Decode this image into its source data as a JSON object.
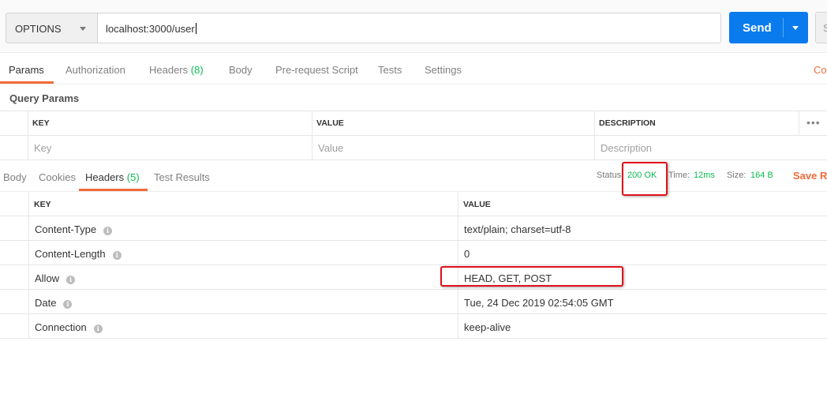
{
  "request": {
    "method": "OPTIONS",
    "url": "localhost:3000/user",
    "send_label": "Send",
    "save_label_partial": "S"
  },
  "request_tabs": {
    "params": "Params",
    "authorization": "Authorization",
    "headers": "Headers",
    "headers_count": "(8)",
    "body": "Body",
    "pre_request": "Pre-request Script",
    "tests": "Tests",
    "settings": "Settings",
    "cookies_partial": "Coo"
  },
  "query_params": {
    "title": "Query Params",
    "columns": [
      "KEY",
      "VALUE",
      "DESCRIPTION"
    ],
    "placeholders": {
      "key": "Key",
      "value": "Value",
      "description": "Description"
    },
    "more": "•••"
  },
  "response_tabs": {
    "body": "Body",
    "cookies": "Cookies",
    "headers": "Headers",
    "headers_count": "(5)",
    "test_results": "Test Results"
  },
  "response_meta": {
    "status_label": "Status:",
    "status_value": "200 OK",
    "time_label": "Time:",
    "time_value": "12ms",
    "size_label": "Size:",
    "size_value": "164 B",
    "save_response_partial": "Save Re"
  },
  "response_headers": {
    "columns": [
      "KEY",
      "VALUE"
    ],
    "rows": [
      {
        "key": "Content-Type",
        "value": "text/plain; charset=utf-8"
      },
      {
        "key": "Content-Length",
        "value": "0"
      },
      {
        "key": "Allow",
        "value": "HEAD, GET, POST"
      },
      {
        "key": "Date",
        "value": "Tue, 24 Dec 2019 02:54:05 GMT"
      },
      {
        "key": "Connection",
        "value": "keep-alive"
      }
    ]
  },
  "colors": {
    "accent_orange": "#f26b3a",
    "send_blue": "#097bed",
    "status_green": "#0cbb52",
    "highlight_red": "#e0101a"
  },
  "icons": {
    "info": "info-icon",
    "dropdown": "chevron-down-icon",
    "more": "more-dots-icon"
  }
}
